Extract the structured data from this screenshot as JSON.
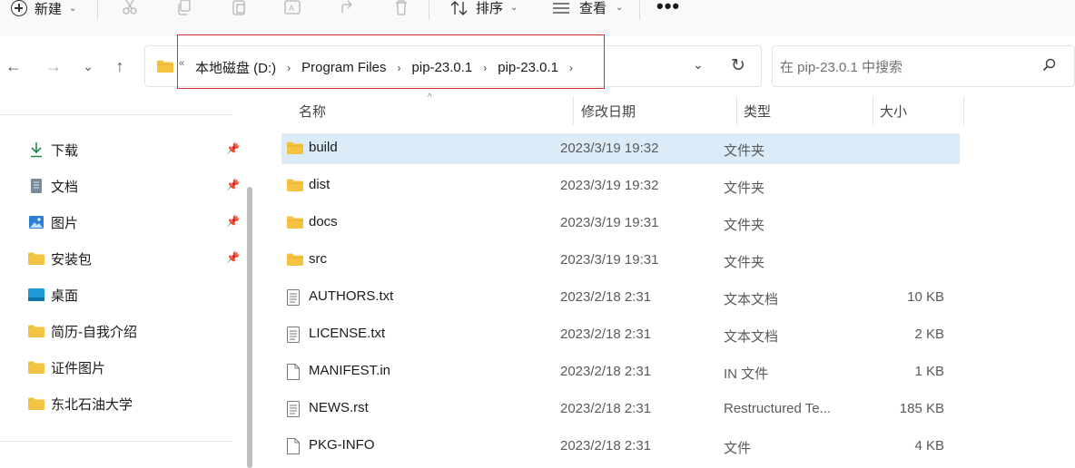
{
  "toolbar": {
    "new_label": "新建",
    "sort_label": "排序",
    "view_label": "查看",
    "more_label": "•••"
  },
  "address": {
    "overflow_label": "«",
    "crumbs": [
      "本地磁盘 (D:)",
      "Program Files",
      "pip-23.0.1",
      "pip-23.0.1"
    ]
  },
  "search": {
    "placeholder": "在 pip-23.0.1 中搜索"
  },
  "sidebar": {
    "items": [
      {
        "label": "下载",
        "icon": "download-icon",
        "pinned": true
      },
      {
        "label": "文档",
        "icon": "document-icon",
        "pinned": true
      },
      {
        "label": "图片",
        "icon": "pictures-icon",
        "pinned": true
      },
      {
        "label": "安装包",
        "icon": "folder-icon",
        "pinned": true
      },
      {
        "label": "桌面",
        "icon": "desktop-icon",
        "pinned": false
      },
      {
        "label": "简历-自我介绍",
        "icon": "folder-icon",
        "pinned": false
      },
      {
        "label": "证件图片",
        "icon": "folder-icon",
        "pinned": false
      },
      {
        "label": "东北石油大学",
        "icon": "folder-icon",
        "pinned": false
      }
    ]
  },
  "columns": {
    "name": "名称",
    "date": "修改日期",
    "type": "类型",
    "size": "大小"
  },
  "files": [
    {
      "name": "build",
      "date": "2023/3/19 19:32",
      "type": "文件夹",
      "size": "",
      "kind": "folder",
      "selected": true
    },
    {
      "name": "dist",
      "date": "2023/3/19 19:32",
      "type": "文件夹",
      "size": "",
      "kind": "folder",
      "selected": false
    },
    {
      "name": "docs",
      "date": "2023/3/19 19:31",
      "type": "文件夹",
      "size": "",
      "kind": "folder",
      "selected": false
    },
    {
      "name": "src",
      "date": "2023/3/19 19:31",
      "type": "文件夹",
      "size": "",
      "kind": "folder",
      "selected": false
    },
    {
      "name": "AUTHORS.txt",
      "date": "2023/2/18 2:31",
      "type": "文本文档",
      "size": "10 KB",
      "kind": "text",
      "selected": false
    },
    {
      "name": "LICENSE.txt",
      "date": "2023/2/18 2:31",
      "type": "文本文档",
      "size": "2 KB",
      "kind": "text",
      "selected": false
    },
    {
      "name": "MANIFEST.in",
      "date": "2023/2/18 2:31",
      "type": "IN 文件",
      "size": "1 KB",
      "kind": "file",
      "selected": false
    },
    {
      "name": "NEWS.rst",
      "date": "2023/2/18 2:31",
      "type": "Restructured Te...",
      "size": "185 KB",
      "kind": "text",
      "selected": false
    },
    {
      "name": "PKG-INFO",
      "date": "2023/2/18 2:31",
      "type": "文件",
      "size": "4 KB",
      "kind": "file",
      "selected": false
    }
  ],
  "colors": {
    "folder": "#f5c342",
    "selection": "#dcebf8",
    "highlight_box": "#d93030"
  }
}
